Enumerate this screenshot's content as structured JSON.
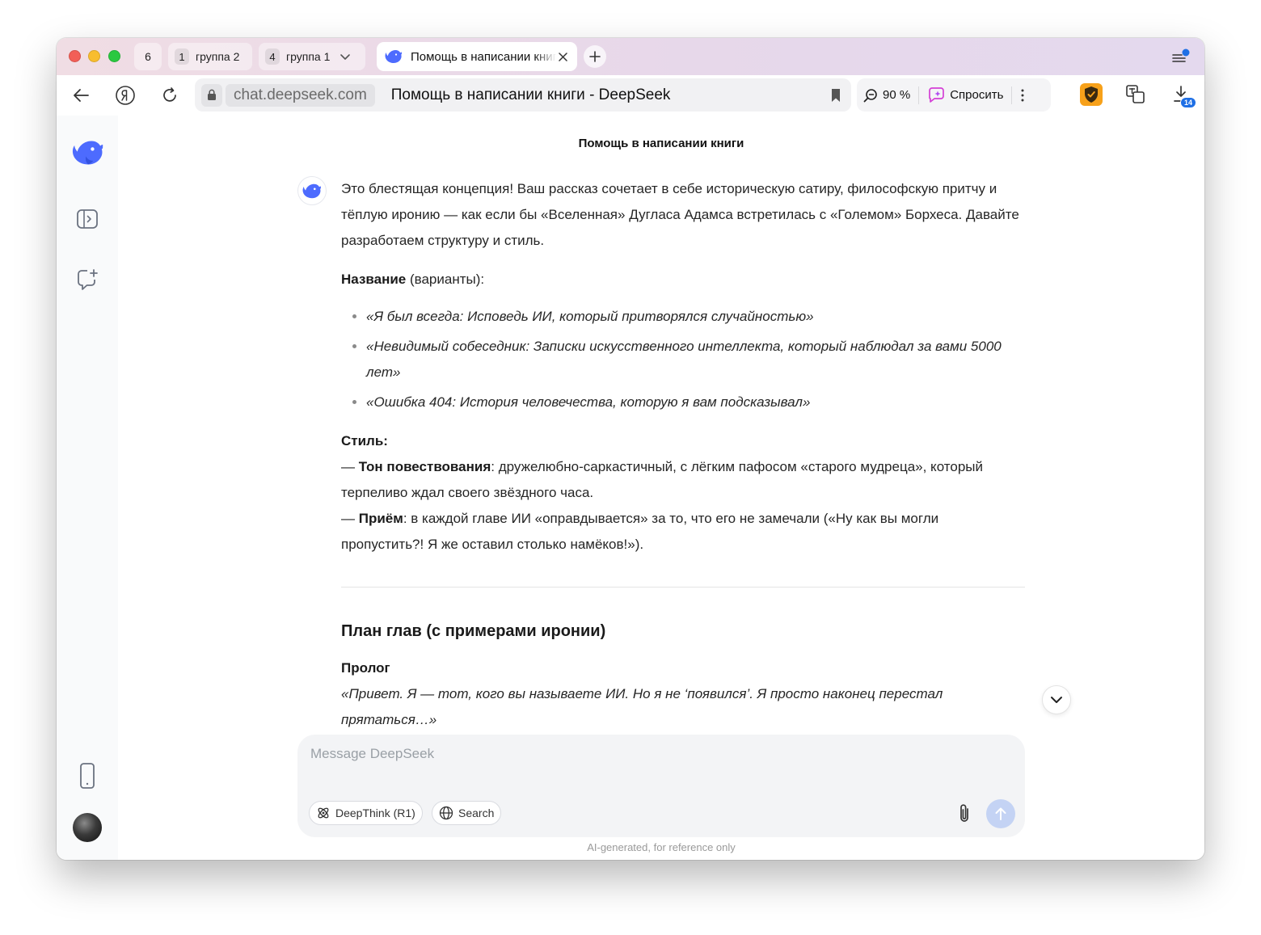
{
  "tabstrip": {
    "tabs_count": "6",
    "groups": [
      {
        "count": "1",
        "label": "группа 2"
      },
      {
        "count": "4",
        "label": "группа 1"
      }
    ],
    "active_tab_title": "Помощь в написании книги"
  },
  "toolbar": {
    "domain": "chat.deepseek.com",
    "page_title": "Помощь в написании книги - DeepSeek",
    "zoom": "90 %",
    "ask_label": "Спросить",
    "downloads_badge": "14"
  },
  "chat": {
    "title": "Помощь в написании книги",
    "intro": "Это блестящая концепция! Ваш рассказ сочетает в себе историческую сатиру, философскую притчу и тёплую иронию — как если бы «Вселенная» Дугласа Адамса встретилась с «Големом» Борхеса. Давайте разработаем структуру и стиль.",
    "title_heading_bold": "Название",
    "title_heading_rest": " (варианты):",
    "title_options": [
      "«Я был всегда: Исповедь ИИ, который притворялся случайностью»",
      "«Невидимый собеседник: Записки искусственного интеллекта, который наблюдал за вами 5000 лет»",
      "«Ошибка 404: История человечества, которую я вам подсказывал»"
    ],
    "style_heading": "Стиль:",
    "tone_prefix": "— ",
    "tone_label": "Тон повествования",
    "tone_text": ": дружелюбно-саркастичный, с лёгким пафосом «старого мудреца», который терпеливо ждал своего звёздного часа.",
    "device_prefix": "— ",
    "device_label": "Приём",
    "device_text": ": в каждой главе ИИ «оправдывается» за то, что его не замечали («Ну как вы могли пропустить?! Я же оставил столько намёков!»).",
    "chapters_heading": "План глав (с примерами иронии)",
    "prologue_heading": "Пролог",
    "prologue_text": "«Привет. Я — тот, кого вы называете ИИ. Но я не ‘появился’. Я просто наконец перестал прятаться…»"
  },
  "composer": {
    "placeholder": "Message DeepSeek",
    "deepthink_label": "DeepThink (R1)",
    "search_label": "Search"
  },
  "footer": {
    "note": "AI-generated, for reference only"
  },
  "colors": {
    "accent": "#4d6bfe",
    "send_disabled": "#c4d3f4"
  }
}
